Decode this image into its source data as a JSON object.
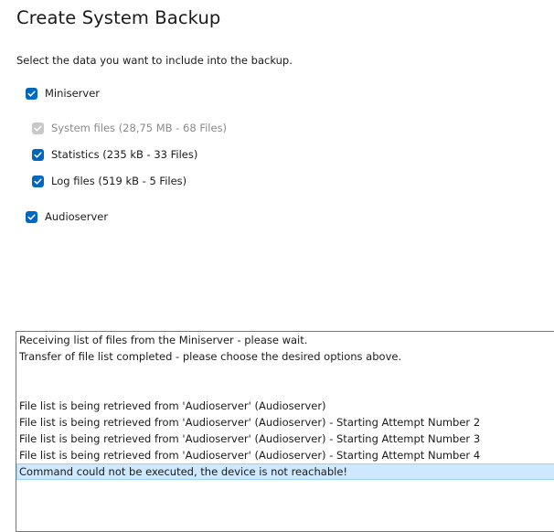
{
  "window": {
    "title": "Create System Backup"
  },
  "instruction": "Select the data you want to include into the backup.",
  "options": {
    "miniserver": {
      "label": "Miniserver",
      "checked": true
    },
    "system_files": {
      "label": "System files (28,75 MB - 68 Files)",
      "checked": true,
      "disabled": true
    },
    "statistics": {
      "label": "Statistics (235 kB - 33 Files)",
      "checked": true
    },
    "log_files": {
      "label": "Log files (519 kB - 5 Files)",
      "checked": true
    },
    "audioserver": {
      "label": "Audioserver",
      "checked": true
    }
  },
  "log": {
    "lines": [
      "Receiving list of files from the Miniserver - please wait.",
      "Transfer of file list completed - please choose the desired options above.",
      "",
      "",
      "File list is being retrieved from 'Audioserver' (Audioserver)",
      "File list is being retrieved from 'Audioserver' (Audioserver) - Starting Attempt Number 2",
      "File list is being retrieved from 'Audioserver' (Audioserver) - Starting Attempt Number 3",
      "File list is being retrieved from 'Audioserver' (Audioserver) - Starting Attempt Number 4",
      "Command could not be executed, the device is not reachable!"
    ],
    "selected_index": 8
  },
  "colors": {
    "accent": "#0067c0",
    "disabled_check": "#c8c8c8",
    "selection": "#cde8ff"
  }
}
